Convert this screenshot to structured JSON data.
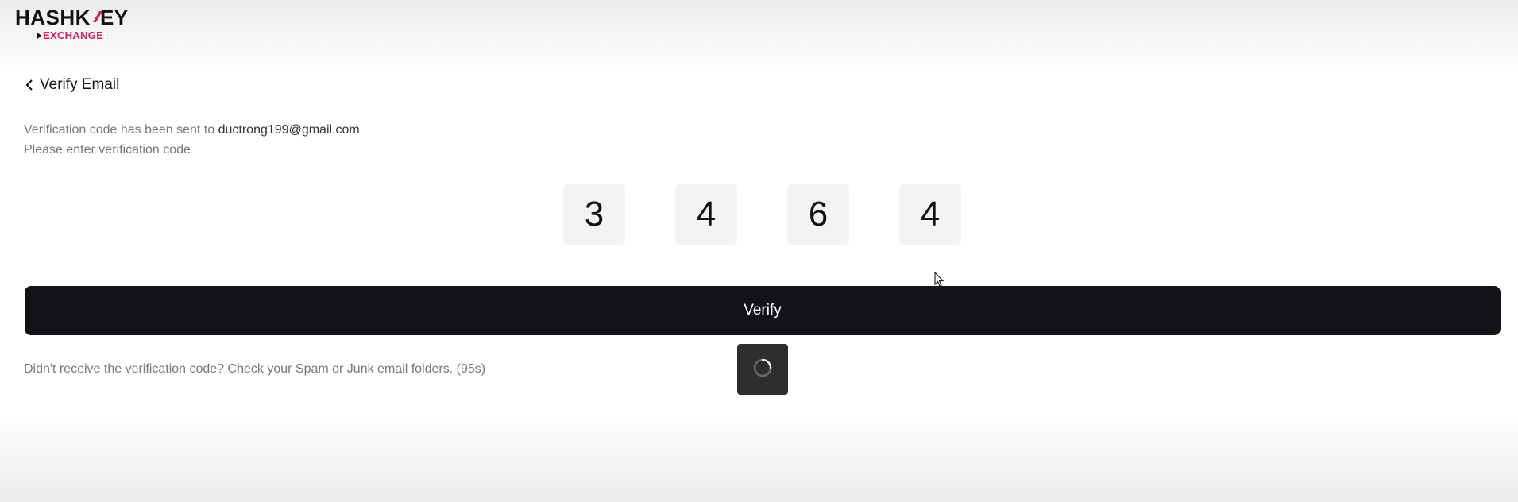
{
  "brand": {
    "name_left": "HASH",
    "name_right": "EY",
    "sub": "EXCHANGE",
    "accent_color": "#c8245f"
  },
  "header": {
    "title": "Verify Email"
  },
  "message": {
    "sent_prefix": "Verification code has been sent to ",
    "email": "ductrong199@gmail.com",
    "instruction": "Please enter verification code"
  },
  "code": {
    "digits": [
      "3",
      "4",
      "6",
      "4"
    ]
  },
  "actions": {
    "verify_label": "Verify"
  },
  "help": {
    "text": "Didn't receive the verification code? Check your Spam or Junk email folders. (95s)"
  },
  "icons": {
    "back": "chevron-left-icon",
    "loading": "loading-spinner-icon",
    "cursor": "mouse-pointer-icon"
  }
}
